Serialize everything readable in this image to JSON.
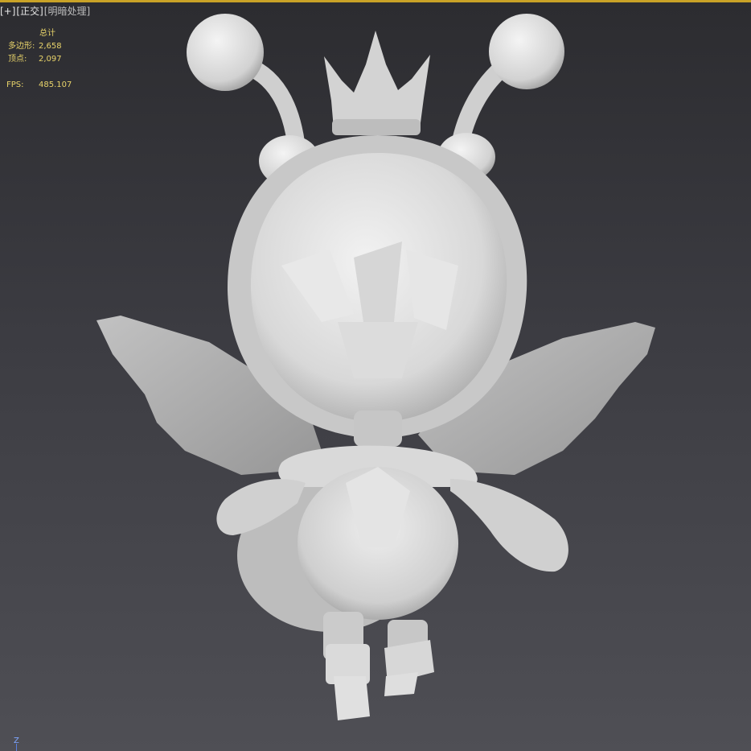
{
  "viewport": {
    "label": {
      "plus": "[+]",
      "view": "[正交]",
      "shading": "[明暗处理]"
    },
    "stats": {
      "header": "总计",
      "polygons_label": "多边形:",
      "polygons_value": "2,658",
      "vertices_label": "顶点:",
      "vertices_value": "2,097",
      "fps_label": "FPS:",
      "fps_value": "485.107"
    },
    "axis_label": "Z"
  },
  "colors": {
    "accent_border": "#c9a227",
    "stats_text": "#e8d36a",
    "background_top": "#2c2c30",
    "background_bottom": "#4f4f55",
    "model": "#d9d9d9"
  }
}
